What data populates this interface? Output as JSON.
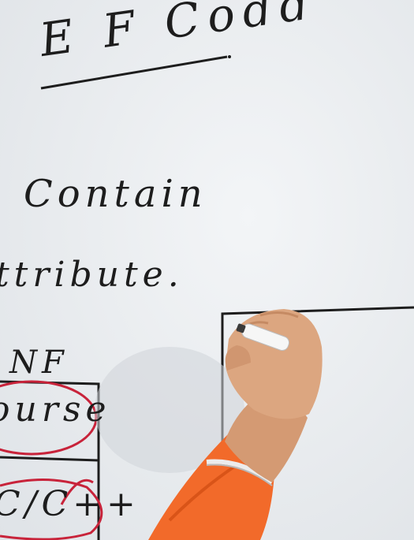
{
  "board": {
    "title": "E F Codd",
    "line1": "Contain",
    "line2": "ttribute.",
    "table_header": "NF",
    "cell1": "ourse",
    "cell2": "C/C++"
  },
  "colors": {
    "ink": "#1d1d1d",
    "red_marker": "#c8233a",
    "sleeve": "#f26a2a",
    "skin": "#d9a07a"
  }
}
